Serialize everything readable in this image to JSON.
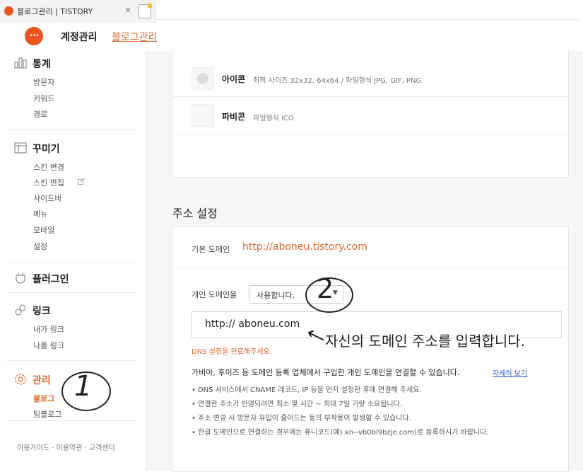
{
  "browser": {
    "tab_title": "블로그관리 | TISTORY",
    "tab_close": "×"
  },
  "header": {
    "nav_account": "계정관리",
    "nav_blog": "블로그관리"
  },
  "sidebar": {
    "stats": {
      "title": "통계",
      "items": [
        "방문자",
        "키워드",
        "경로"
      ]
    },
    "decorate": {
      "title": "꾸미기",
      "items": [
        "스킨 변경",
        "스킨 편집",
        "사이드바",
        "메뉴",
        "모바일",
        "설정"
      ]
    },
    "plugin": {
      "title": "플러그인"
    },
    "link": {
      "title": "링크",
      "items": [
        "내가 링크",
        "나를 링크"
      ]
    },
    "manage": {
      "title": "관리",
      "items": [
        "블로그",
        "팀블로그"
      ]
    },
    "footer": "이용가이드 · 이용약관 · 고객센터"
  },
  "icon_settings": {
    "icon_label": "아이콘",
    "icon_desc": "최적 사이즈 32x32, 64x64 / 파일형식 JPG, GIF, PNG",
    "favicon_label": "파비콘",
    "favicon_desc": "파일형식 ICO"
  },
  "address": {
    "heading": "주소 설정",
    "default_label": "기본 도메인",
    "default_domain": "http://aboneu.tistory.com",
    "custom_label": "개인 도메인을",
    "custom_select": "사용합니다.",
    "custom_value": "http:// aboneu.com",
    "error": "DNS 설정을 완료해주세요.",
    "description": "가비아, 후이즈 등 도메인 등록 업체에서 구입한 개인 도메인을 연결할 수 있습니다.",
    "more_link": "자세히 보기",
    "bullets": [
      "DNS 서비스에서 CNAME 레코드, IP 등을 먼저 설정한 후에 연결해 주세요.",
      "연결한 주소가 반영되려면 최소 몇 시간 ~ 최대 7일 가량 소요됩니다.",
      "주소 변경 시 방문자 유입이 줄어드는 등의 부작용이 발생할 수 있습니다.",
      "한글 도메인으로 연결하는 경우에는 퓨니코드(예) xn--vb0bl9bzje.com)로 등록하시기 바랍니다."
    ]
  },
  "annotations": {
    "arrow_note": "자신의 도메인 주소를 입력합니다.",
    "step1": "1",
    "step2": "2"
  },
  "colors": {
    "accent": "#e0692d",
    "logo": "#eb531f",
    "link": "#2a56c6"
  }
}
